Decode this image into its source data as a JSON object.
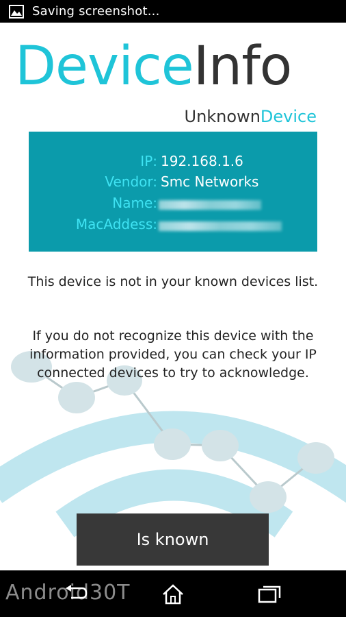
{
  "status_bar": {
    "text": "Saving screenshot..."
  },
  "title": {
    "part1": "Device",
    "part2": "Info"
  },
  "device_name": {
    "part1": "Unknown",
    "part2": "Device"
  },
  "info": {
    "ip_label": "IP:",
    "ip_value": "192.168.1.6",
    "vendor_label": "Vendor:",
    "vendor_value": "Smc Networks",
    "name_label": "Name:",
    "mac_label": "MacAddess:"
  },
  "messages": {
    "not_known": "This device is not in your known devices list.",
    "advice": "If you do not recognize this device with the information provided, you can check your IP connected devices to try to acknowledge."
  },
  "button": {
    "label": "Is known"
  },
  "watermark": "Android30T",
  "colors": {
    "accent": "#1fc4d8",
    "card": "#0b9bab",
    "label": "#3fe3f3",
    "button": "#383838"
  }
}
